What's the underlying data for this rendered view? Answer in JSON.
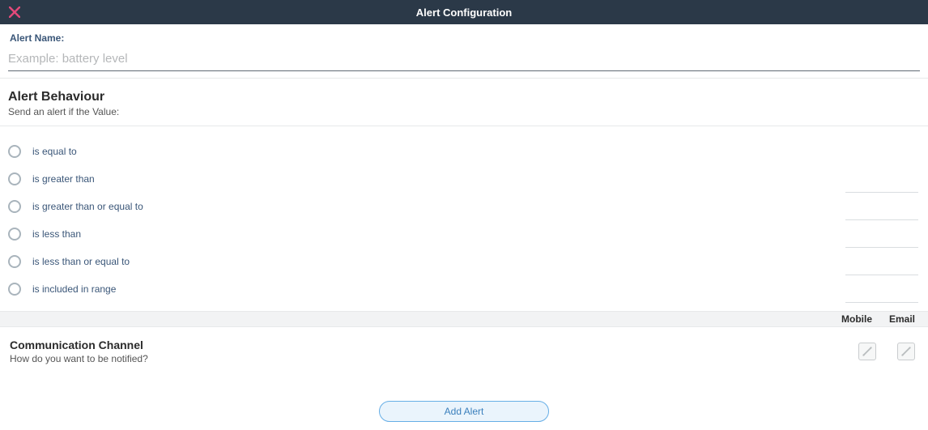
{
  "header": {
    "title": "Alert Configuration"
  },
  "nameSection": {
    "label": "Alert Name:",
    "placeholder": "Example: battery level",
    "value": ""
  },
  "behaviour": {
    "title": "Alert Behaviour",
    "subtitle": "Send an alert if the Value:",
    "options": [
      "is equal to",
      "is greater than",
      "is greater than or equal to",
      "is less than",
      "is less than or equal to",
      "is included in range"
    ]
  },
  "channel": {
    "headers": {
      "mobile": "Mobile",
      "email": "Email"
    },
    "title": "Communication Channel",
    "subtitle": "How do you want to be notified?"
  },
  "footer": {
    "addLabel": "Add Alert"
  }
}
